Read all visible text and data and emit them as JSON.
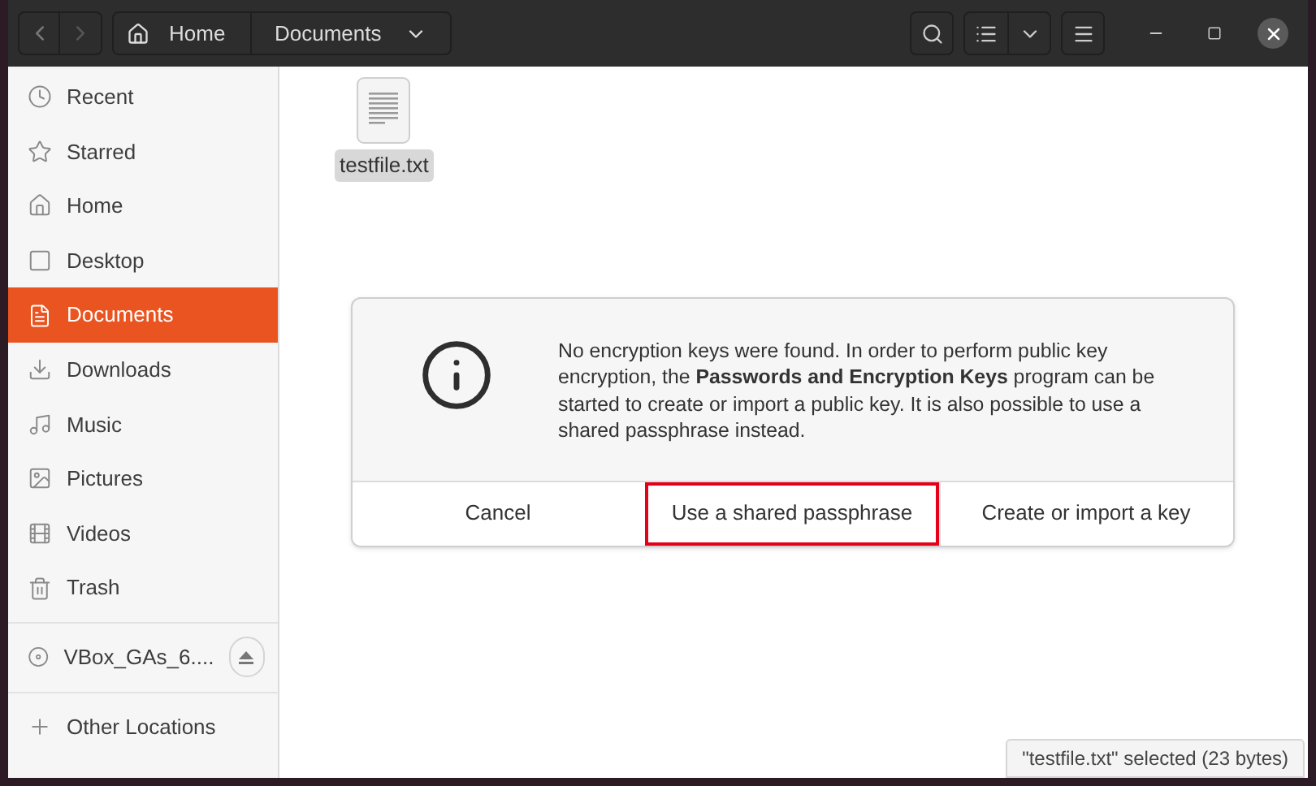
{
  "header": {
    "path": [
      {
        "label": "Home"
      },
      {
        "label": "Documents"
      }
    ]
  },
  "sidebar": {
    "places": [
      {
        "label": "Recent",
        "selected": false
      },
      {
        "label": "Starred",
        "selected": false
      },
      {
        "label": "Home",
        "selected": false
      },
      {
        "label": "Desktop",
        "selected": false
      },
      {
        "label": "Documents",
        "selected": true
      },
      {
        "label": "Downloads",
        "selected": false
      },
      {
        "label": "Music",
        "selected": false
      },
      {
        "label": "Pictures",
        "selected": false
      },
      {
        "label": "Videos",
        "selected": false
      },
      {
        "label": "Trash",
        "selected": false
      }
    ],
    "devices": [
      {
        "label": "VBox_GAs_6....",
        "selected": false
      }
    ],
    "other": [
      {
        "label": "Other Locations",
        "selected": false
      }
    ]
  },
  "files": [
    {
      "name": "testfile.txt",
      "selected": true
    }
  ],
  "dialog": {
    "message": "No encryption keys were found. In order to perform public key encryption, the **Passwords and Encryption Keys** program can be started to create or import a public key. It is also possible to use a shared passphrase instead.",
    "buttons": [
      {
        "label": "Cancel",
        "highlighted": false
      },
      {
        "label": "Use a shared passphrase",
        "highlighted": true
      },
      {
        "label": "Create or import a key",
        "highlighted": false
      }
    ]
  },
  "status": "\"testfile.txt\" selected  (23 bytes)"
}
